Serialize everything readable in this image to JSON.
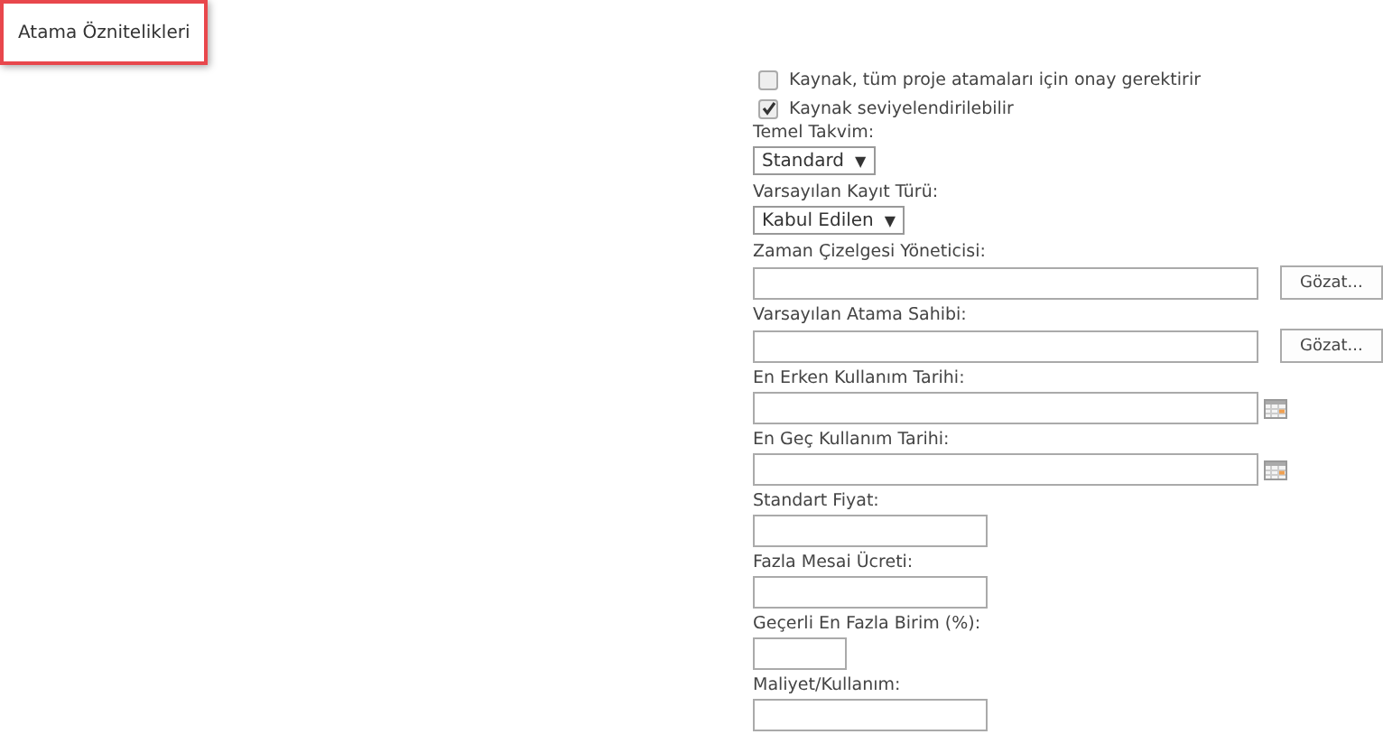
{
  "section_tab": {
    "label": "Atama Öznitelikleri",
    "selected": true
  },
  "fields": [
    {
      "kind": "checkbox",
      "label": "Kaynak, tüm proje atamaları için onay gerektirir",
      "checked": false
    },
    {
      "kind": "checkbox",
      "label": "Kaynak seviyelendirilebilir",
      "checked": true
    },
    {
      "kind": "select",
      "label": "Temel Takvim:",
      "value": "Standard",
      "arrow": "▼"
    },
    {
      "kind": "select",
      "label": "Varsayılan Kayıt Türü:",
      "value": "Kabul Edilen",
      "arrow": "▼"
    },
    {
      "kind": "people",
      "label": "Zaman Çizelgesi Yöneticisi:",
      "button": "Gözat..."
    },
    {
      "kind": "people",
      "label": "Varsayılan Atama Sahibi:",
      "button": "Gözat..."
    },
    {
      "kind": "date",
      "label": "En Erken Kullanım Tarihi:"
    },
    {
      "kind": "date",
      "label": "En Geç Kullanım Tarihi:"
    },
    {
      "kind": "number",
      "label": "Standart Fiyat:"
    },
    {
      "kind": "number",
      "label": "Fazla Mesai Ücreti:"
    },
    {
      "kind": "percent",
      "label": "Geçerli En Fazla Birim (%):"
    },
    {
      "kind": "number",
      "label": "Maliyet/Kullanım:"
    }
  ]
}
